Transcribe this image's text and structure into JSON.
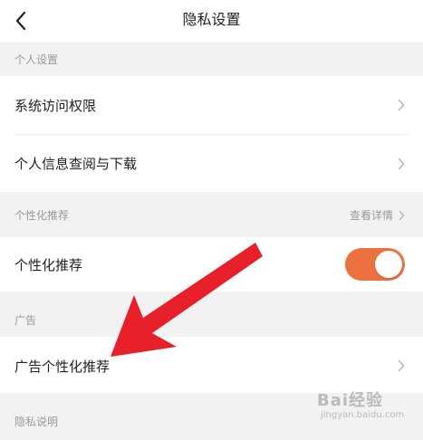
{
  "header": {
    "title": "隐私设置",
    "back_icon": "chevron-left-icon"
  },
  "sections": {
    "personal": {
      "header": "个人设置",
      "items": [
        {
          "label": "系统访问权限",
          "icon": "chevron-right-icon"
        },
        {
          "label": "个人信息查阅与下载",
          "icon": "chevron-right-icon"
        }
      ]
    },
    "personalization": {
      "header": "个性化推荐",
      "detail_link": "查看详情",
      "item": {
        "label": "个性化推荐",
        "toggle_on": true
      }
    },
    "ads": {
      "header": "广告",
      "item": {
        "label": "广告个性化推荐",
        "icon": "chevron-right-icon"
      }
    },
    "privacy_note": {
      "header": "隐私说明"
    }
  },
  "colors": {
    "toggle_on": "#ec7040",
    "annotation_arrow": "#e8202a",
    "background": "#f2f2f2"
  },
  "watermark": {
    "brand": "Bai经验",
    "url": "jingyan.baidu.com"
  }
}
